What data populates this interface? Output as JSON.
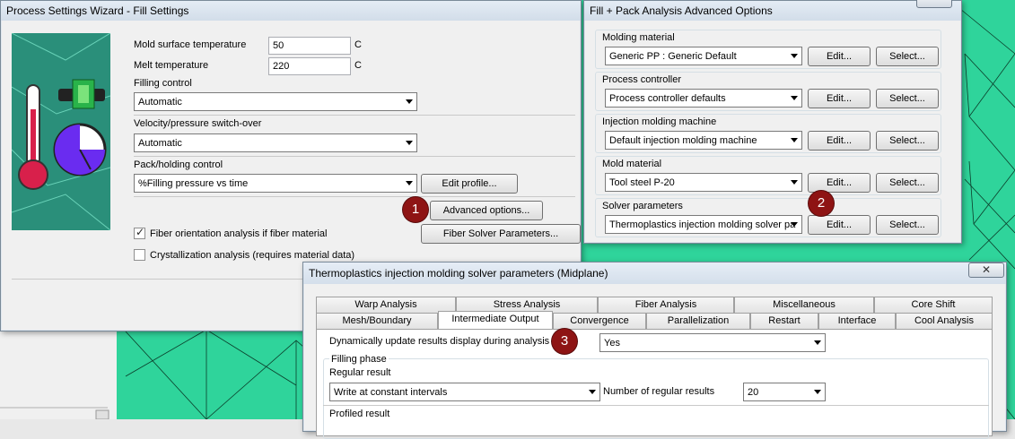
{
  "colors": {
    "mesh": "#2fd49b",
    "badge": "#8e1414",
    "window_bg": "#f0f0f0",
    "title_bar": "#d8e2ee"
  },
  "process_wizard": {
    "title": "Process Settings Wizard - Fill Settings",
    "mold_surface_temp": {
      "label": "Mold surface temperature",
      "value": "50",
      "unit": "C"
    },
    "melt_temp": {
      "label": "Melt temperature",
      "value": "220",
      "unit": "C"
    },
    "filling_control": {
      "label": "Filling control",
      "value": "Automatic"
    },
    "vp_switchover": {
      "label": "Velocity/pressure switch-over",
      "value": "Automatic"
    },
    "pack_holding": {
      "label": "Pack/holding control",
      "value": "%Filling pressure vs time",
      "edit_profile": "Edit profile..."
    },
    "advanced_options": "Advanced options...",
    "fiber_orientation": {
      "label": "Fiber orientation analysis if fiber material",
      "checked": true
    },
    "fiber_solver_params": "Fiber Solver Parameters...",
    "crystallization": {
      "label": "Crystallization analysis (requires material data)",
      "checked": false
    }
  },
  "advanced_dialog": {
    "title": "Fill + Pack Analysis Advanced Options",
    "groups": [
      {
        "label": "Molding material",
        "value": "Generic PP : Generic Default",
        "edit": "Edit...",
        "select": "Select..."
      },
      {
        "label": "Process controller",
        "value": "Process controller defaults",
        "edit": "Edit...",
        "select": "Select..."
      },
      {
        "label": "Injection molding machine",
        "value": "Default injection molding machine",
        "edit": "Edit...",
        "select": "Select..."
      },
      {
        "label": "Mold material",
        "value": "Tool steel P-20",
        "edit": "Edit...",
        "select": "Select..."
      },
      {
        "label": "Solver parameters",
        "value": "Thermoplastics injection molding solver pa",
        "edit": "Edit...",
        "select": "Select..."
      }
    ]
  },
  "solver_dialog": {
    "title": "Thermoplastics injection molding solver parameters (Midplane)",
    "tabs_row1": [
      "Warp Analysis",
      "Stress Analysis",
      "Fiber Analysis",
      "Miscellaneous",
      "Core Shift"
    ],
    "tabs_row2": [
      "Mesh/Boundary",
      "Intermediate Output",
      "Convergence",
      "Parallelization",
      "Restart",
      "Interface",
      "Cool Analysis"
    ],
    "dynamic_update": {
      "label": "Dynamically update results display during analysis",
      "value": "Yes"
    },
    "filling_phase": "Filling phase",
    "regular_result": {
      "label": "Regular result",
      "value": "Write at constant intervals",
      "count_label": "Number of regular results",
      "count_value": "20"
    },
    "profiled_result": "Profiled result"
  },
  "badges": [
    "1",
    "2",
    "3"
  ],
  "close_glyph": "✕"
}
